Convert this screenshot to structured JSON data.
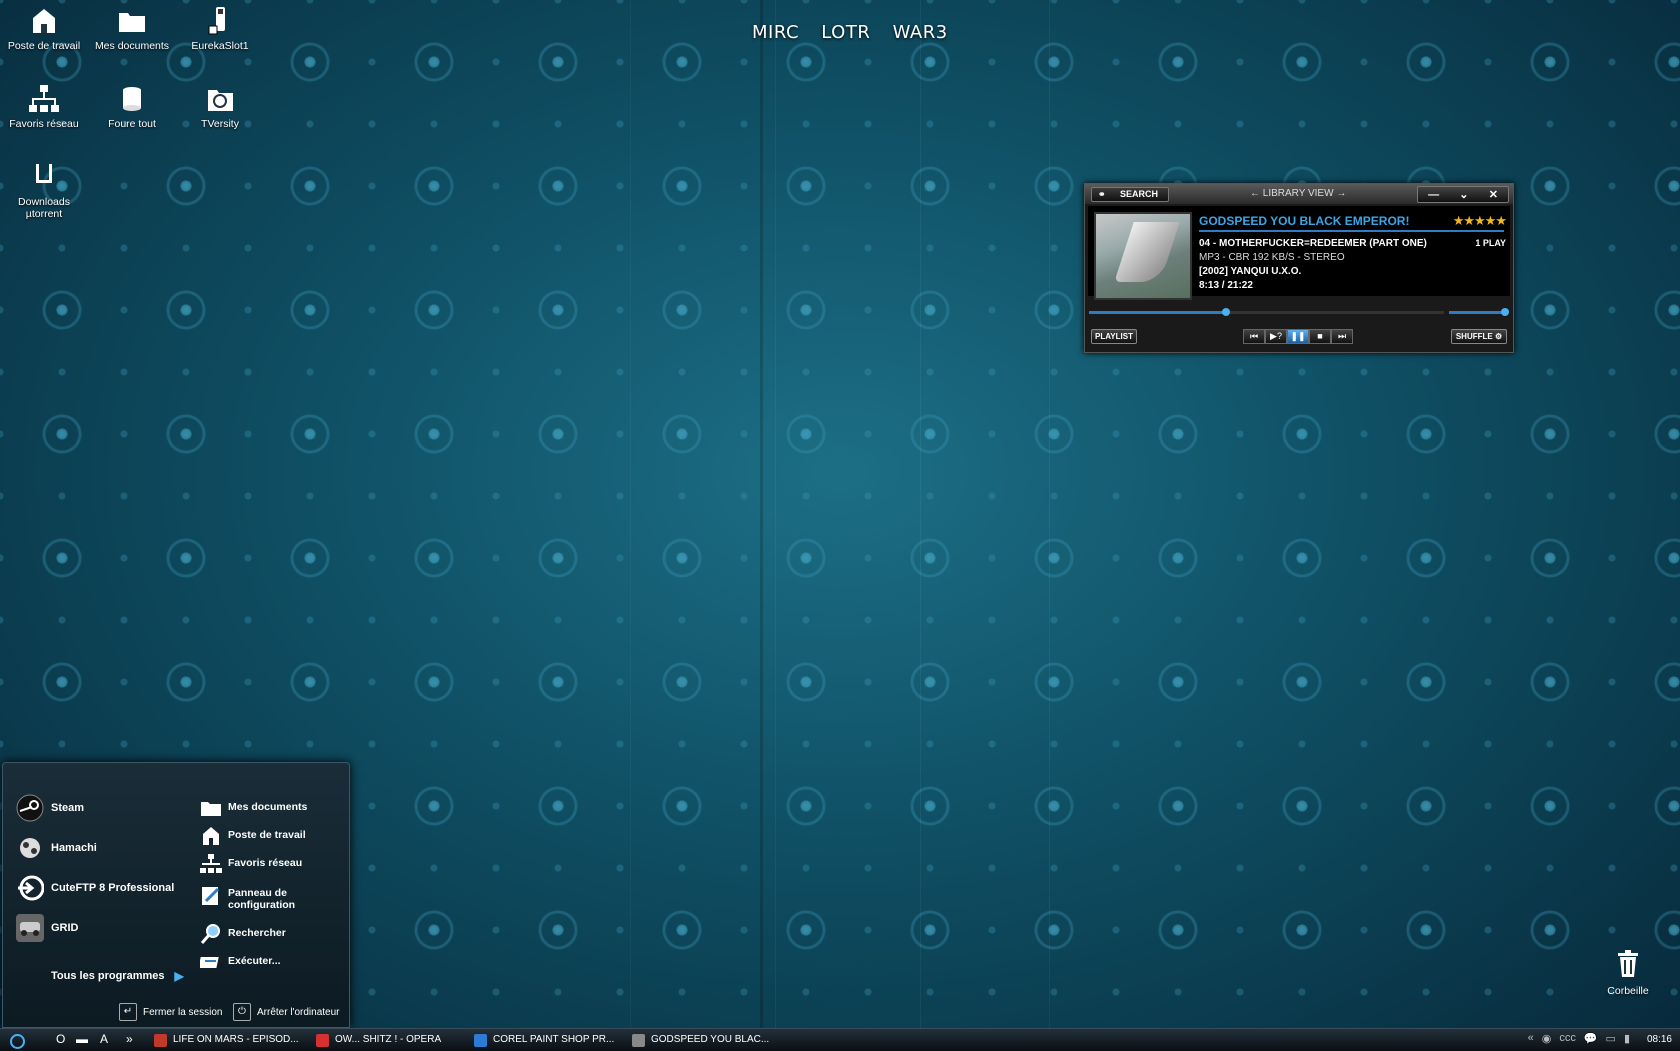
{
  "desktop": {
    "icons": [
      {
        "label": "Poste de travail",
        "icon": "computer-icon"
      },
      {
        "label": "Mes documents",
        "icon": "folder-icon"
      },
      {
        "label": "EurekaSlot1",
        "icon": "usb-drive-icon"
      },
      {
        "label": "Favoris réseau",
        "icon": "network-icon"
      },
      {
        "label": "Foure tout",
        "icon": "drive-icon"
      },
      {
        "label": "TVersity",
        "icon": "tversity-icon"
      },
      {
        "label": "Downloads µtorrent",
        "icon": "downloads-folder-icon"
      },
      {
        "label": "Corbeille",
        "icon": "trash-icon"
      }
    ],
    "top_menu": [
      "MIRC",
      "LOTR",
      "WAR3"
    ]
  },
  "player": {
    "search_label": "SEARCH",
    "view_label": "← LIBRARY VIEW →",
    "artist": "GODSPEED YOU BLACK EMPEROR!",
    "rating_stars": "★★★★★",
    "plays": "1 PLAY",
    "track": "04 - MOTHERFUCKER=REDEEMER (PART ONE)",
    "format": "MP3 - CBR 192 KB/S - STEREO",
    "album": "[2002] YANQUI U.X.O.",
    "time": "8:13 / 21:22",
    "progress_fraction": 0.385,
    "volume_fraction": 1.0,
    "playlist_label": "PLAYLIST",
    "shuffle_label": "SHUFFLE",
    "controls": [
      "prev",
      "random",
      "pause",
      "stop",
      "next"
    ],
    "accent_color": "#3aa6e8"
  },
  "start_menu": {
    "pinned": [
      {
        "label": "Steam",
        "icon": "steam-icon"
      },
      {
        "label": "Hamachi",
        "icon": "hamachi-icon"
      },
      {
        "label": "CuteFTP 8 Professional",
        "icon": "cuteftp-icon"
      },
      {
        "label": "GRID",
        "icon": "grid-game-icon"
      }
    ],
    "all_programs": "Tous les programmes",
    "right": [
      {
        "label": "Mes documents",
        "icon": "folder-icon"
      },
      {
        "label": "Poste de travail",
        "icon": "computer-icon"
      },
      {
        "label": "Favoris réseau",
        "icon": "network-icon"
      },
      {
        "label": "Panneau de configuration",
        "icon": "control-panel-icon"
      },
      {
        "label": "Rechercher",
        "icon": "search-icon"
      },
      {
        "label": "Exécuter...",
        "icon": "run-icon"
      }
    ],
    "logoff": "Fermer la session",
    "shutdown": "Arrêter l'ordinateur"
  },
  "taskbar": {
    "tasks": [
      {
        "label": "LIFE ON MARS - EPISOD...",
        "color": "#c0392b"
      },
      {
        "label": "OW... SHITZ ! - OPERA",
        "color": "#d63031"
      },
      {
        "label": "COREL PAINT SHOP PR...",
        "color": "#2d7bd6"
      },
      {
        "label": "GODSPEED YOU BLAC...",
        "color": "#888888"
      }
    ],
    "tray_text": "ccc",
    "clock": "08:16"
  }
}
